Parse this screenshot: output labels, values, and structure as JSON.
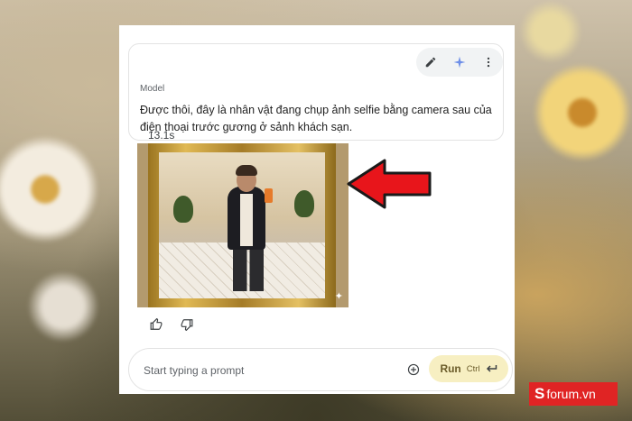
{
  "message": {
    "role_label": "Model",
    "text": "Được thôi, đây là nhân vật đang chụp ảnh selfie bằng camera sau của điện thoại trước gương ở sảnh khách sạn.",
    "timing": "13.1s",
    "toolbar_icons": [
      "edit-pencil-icon",
      "sparkle-icon",
      "more-vert-icon"
    ]
  },
  "feedback_icons": [
    "thumb-up-icon",
    "thumb-down-icon"
  ],
  "prompt": {
    "placeholder": "Start typing a prompt",
    "value": "",
    "run_label": "Run",
    "run_shortcut": "Ctrl"
  },
  "annotation": {
    "color": "#e8151b"
  },
  "watermark": {
    "logo": "S",
    "text": "forum.vn",
    "color": "#e02424"
  },
  "theme": {
    "accent": "#8ab4f8",
    "run_bg": "#f7efc2"
  }
}
